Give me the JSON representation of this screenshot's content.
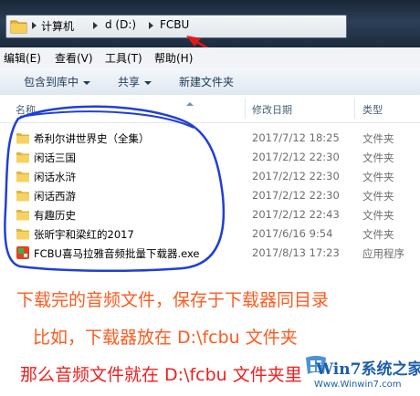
{
  "address_bar": {
    "segments": [
      "计算机",
      "d (D:)",
      "FCBU"
    ]
  },
  "menu": {
    "items": [
      "编辑(E)",
      "查看(V)",
      "工具(T)",
      "帮助(H)"
    ]
  },
  "toolbar": {
    "include_label": "包含到库中",
    "share_label": "共享",
    "new_folder_label": "新建文件夹"
  },
  "columns": {
    "name": "名称",
    "date": "修改日期",
    "type": "类型"
  },
  "files": [
    {
      "name": "希利尔讲世界史（全集）",
      "date": "2017/7/12 18:25",
      "type": "文件夹",
      "icon": "folder-icon"
    },
    {
      "name": "闲话三国",
      "date": "2017/2/12 22:30",
      "type": "文件夹",
      "icon": "folder-icon"
    },
    {
      "name": "闲话水浒",
      "date": "2017/2/12 22:30",
      "type": "文件夹",
      "icon": "folder-icon"
    },
    {
      "name": "闲话西游",
      "date": "2017/2/12 22:30",
      "type": "文件夹",
      "icon": "folder-icon"
    },
    {
      "name": "有趣历史",
      "date": "2017/2/12 22:43",
      "type": "文件夹",
      "icon": "folder-icon"
    },
    {
      "name": "张昕宇和梁红的2017",
      "date": "2017/6/16 9:54",
      "type": "文件夹",
      "icon": "folder-icon"
    },
    {
      "name": "FCBU喜马拉雅音频批量下载器.exe",
      "date": "2017/8/13 17:23",
      "type": "应用程序",
      "icon": "app-icon"
    }
  ],
  "annotations": {
    "line1": "下载完的音频文件，保存于下载器同目录",
    "line2": "比如，下载器放在 D:\\fcbu 文件夹",
    "line3": "那么音频文件就在 D:\\fcbu 文件夹里"
  },
  "watermark": {
    "site": "Win7系统之家",
    "url": "Www.Winwin7.com"
  },
  "colors": {
    "annotation_orange": "#ff5a1e",
    "annotation_red": "#f01e1e",
    "scribble_blue": "#1f3fd8",
    "arrow_red": "#e01818"
  }
}
